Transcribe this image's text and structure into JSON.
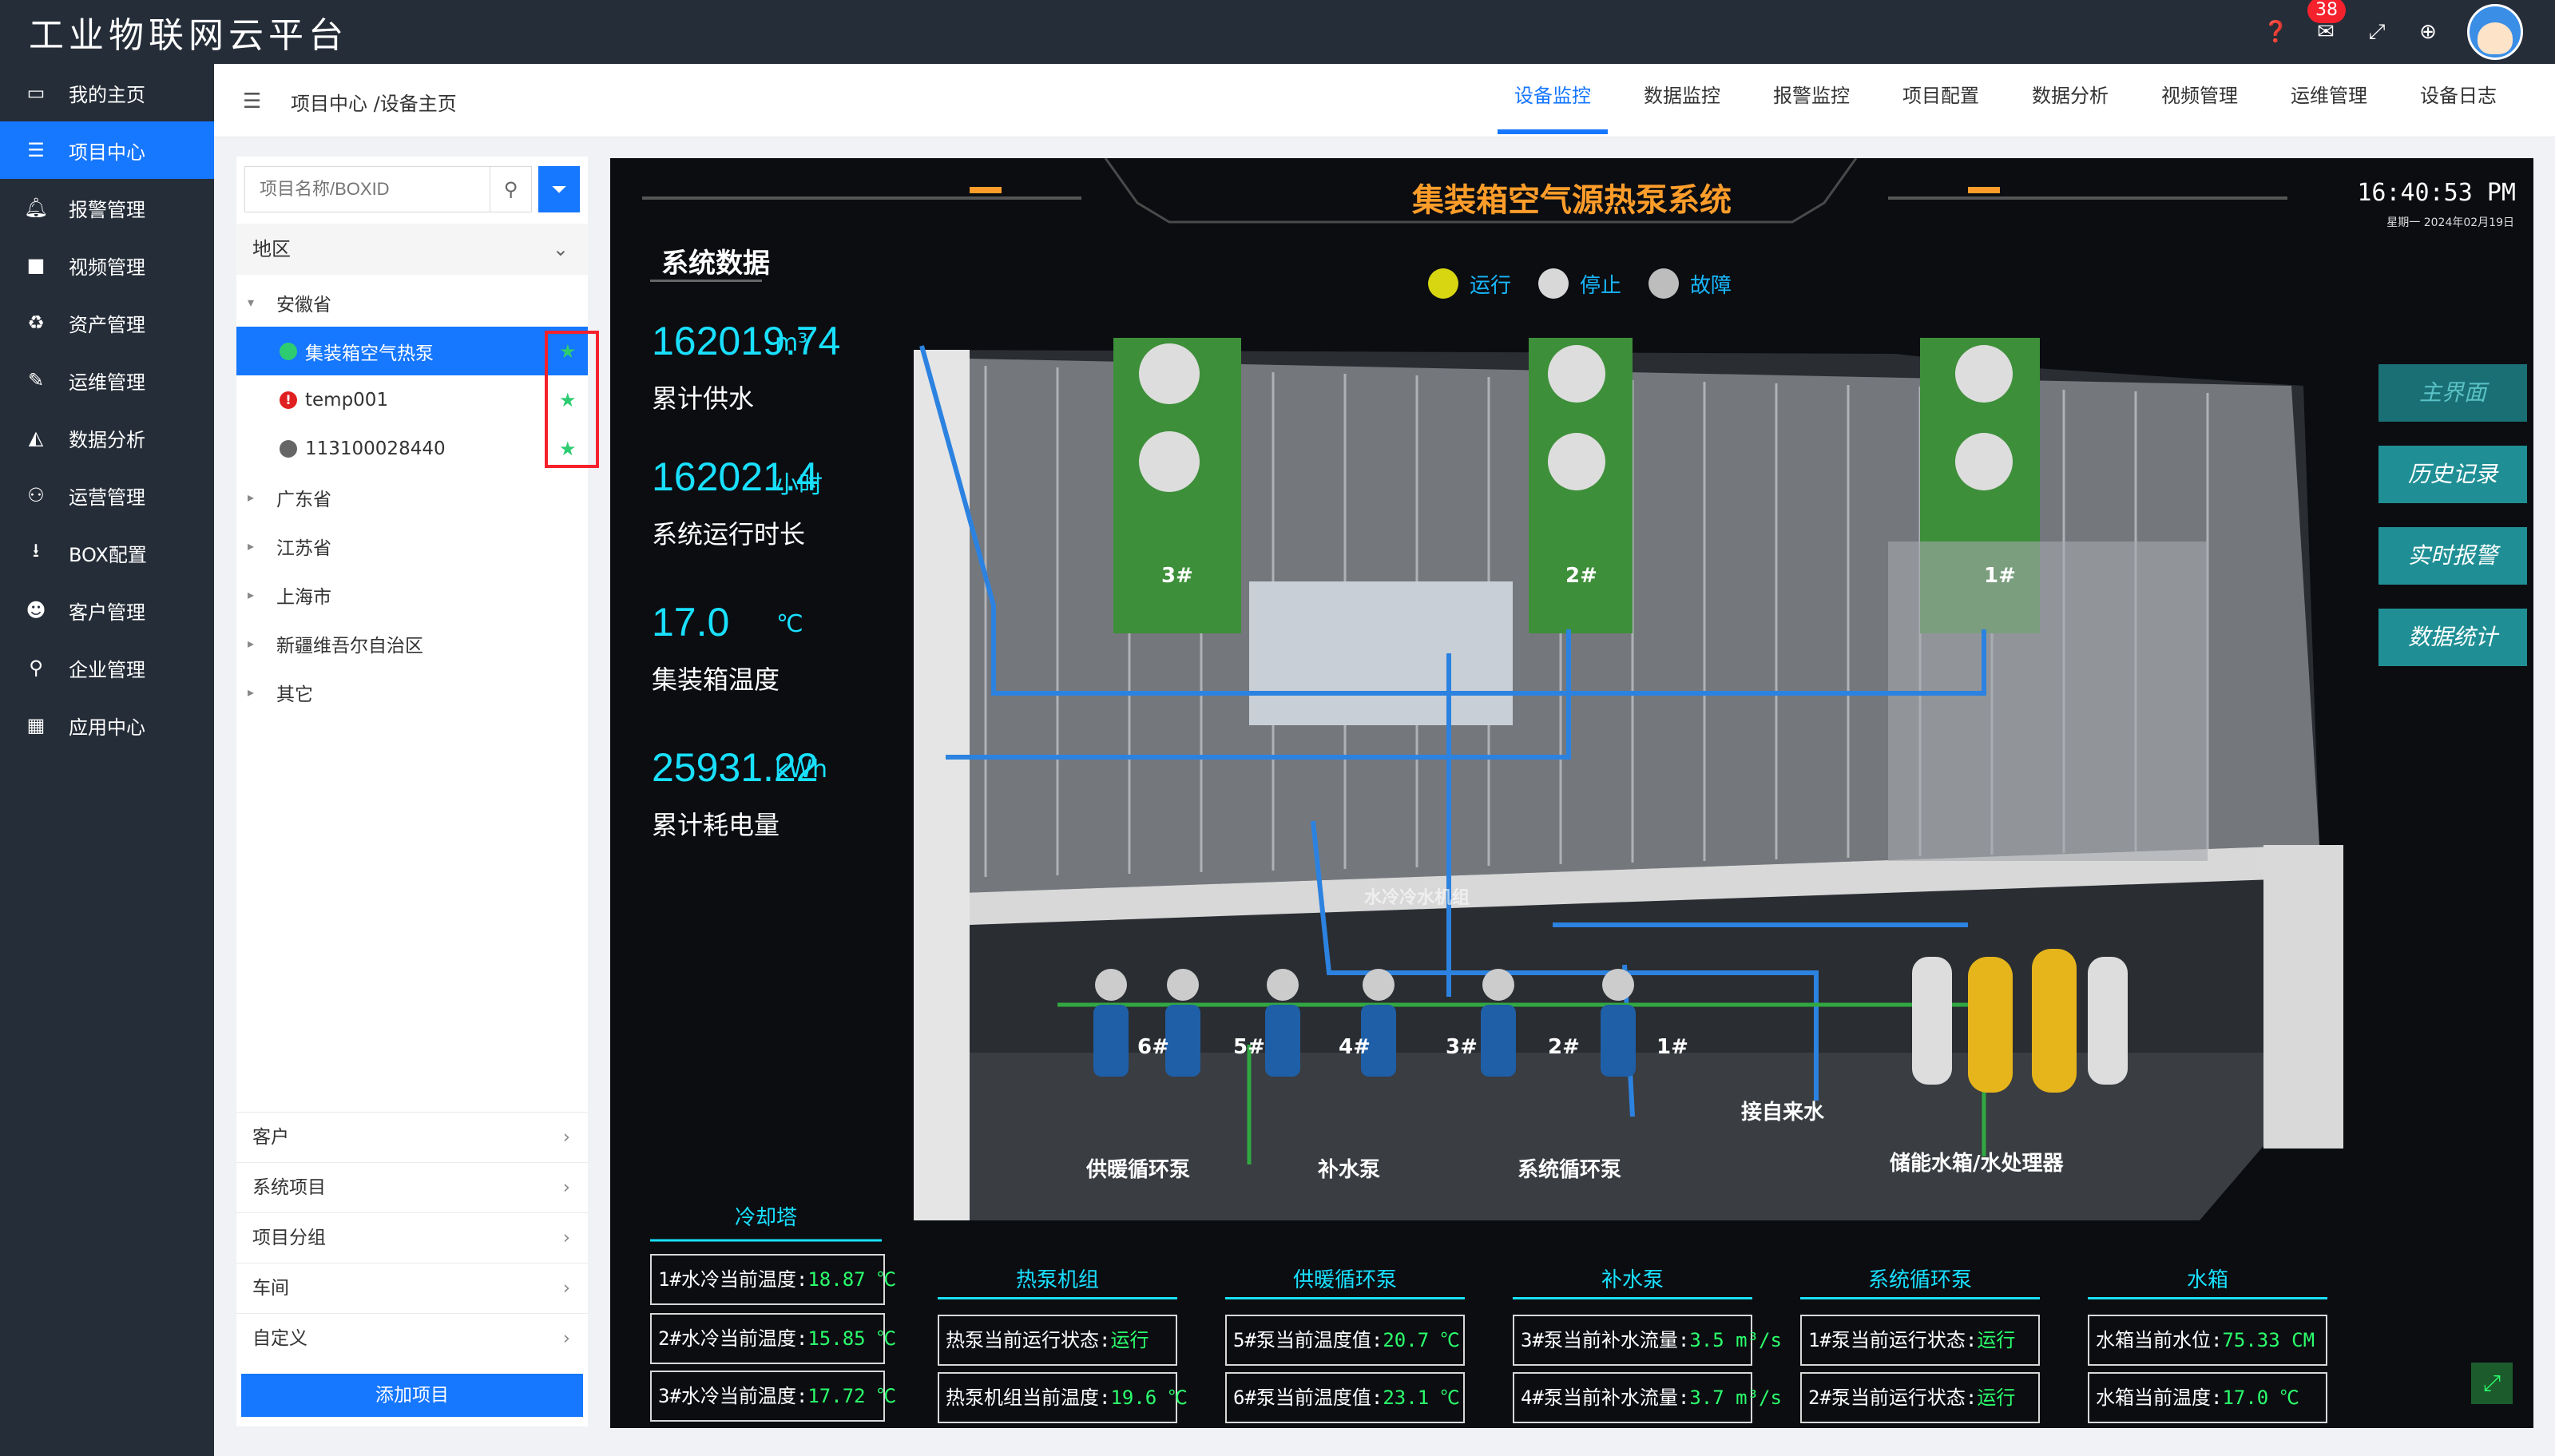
{
  "app": {
    "title": "工业物联网云平台",
    "notification_count": "38"
  },
  "sidebar": {
    "items": [
      {
        "label": "我的主页",
        "icon": "monitor-icon"
      },
      {
        "label": "项目中心",
        "icon": "list-icon"
      },
      {
        "label": "报警管理",
        "icon": "bell-icon"
      },
      {
        "label": "视频管理",
        "icon": "video-icon"
      },
      {
        "label": "资产管理",
        "icon": "recycle-icon"
      },
      {
        "label": "运维管理",
        "icon": "wrench-icon"
      },
      {
        "label": "数据分析",
        "icon": "chart-icon"
      },
      {
        "label": "运营管理",
        "icon": "users-icon"
      },
      {
        "label": "BOX配置",
        "icon": "download-icon"
      },
      {
        "label": "客户管理",
        "icon": "group-icon"
      },
      {
        "label": "企业管理",
        "icon": "sitemap-icon"
      },
      {
        "label": "应用中心",
        "icon": "grid-icon"
      }
    ]
  },
  "breadcrumb": "项目中心 /设备主页",
  "tabs": [
    "设备监控",
    "数据监控",
    "报警监控",
    "项目配置",
    "数据分析",
    "视频管理",
    "运维管理",
    "设备日志"
  ],
  "search": {
    "placeholder": "项目名称/BOXID"
  },
  "region_label": "地区",
  "tree": {
    "province": "安徽省",
    "devices": [
      {
        "name": "集装箱空气热泵",
        "status": "green"
      },
      {
        "name": "temp001",
        "status": "red"
      },
      {
        "name": "113100028440",
        "status": "grey"
      }
    ],
    "other_regions": [
      "广东省",
      "江苏省",
      "上海市",
      "新疆维吾尔自治区",
      "其它"
    ]
  },
  "bottom_menu": [
    "客户",
    "系统项目",
    "项目分组",
    "车间",
    "自定义"
  ],
  "add_button": "添加项目",
  "scada": {
    "title": "集装箱空气源热泵系统",
    "time": "16:40:53 PM",
    "date": "星期一    2024年02月19日",
    "section_title": "系统数据",
    "stats": [
      {
        "value": "162019.74",
        "unit": "m³",
        "label": "累计供水"
      },
      {
        "value": "162021.4",
        "unit": "小时",
        "label": "系统运行时长"
      },
      {
        "value": "17.0",
        "unit": "℃",
        "label": "集装箱温度"
      },
      {
        "value": "25931.22",
        "unit": "kWh",
        "label": "累计耗电量"
      }
    ],
    "legend": [
      {
        "label": "运行",
        "color": "#d7d611"
      },
      {
        "label": "停止",
        "color": "#d8d8d8"
      },
      {
        "label": "故障",
        "color": "#bdbdbd"
      }
    ],
    "right_buttons": [
      "主界面",
      "历史记录",
      "实时报警",
      "数据统计"
    ],
    "scene_labels": {
      "units": [
        "3#",
        "2#",
        "1#"
      ],
      "pumps": [
        "6#",
        "5#",
        "4#",
        "3#",
        "2#",
        "1#"
      ],
      "chiller": "水冷冷水机组",
      "inlet": "接自来水",
      "heat_pump": "供暖循环泵",
      "makeup_pump": "补水泵",
      "sys_pump": "系统循环泵",
      "tank": "储能水箱/水处理器"
    },
    "panels": [
      {
        "title": "冷却塔",
        "rows": [
          {
            "label": "1#水冷当前温度:",
            "value": "18.87 ℃"
          },
          {
            "label": "2#水冷当前温度:",
            "value": "15.85 ℃"
          },
          {
            "label": "3#水冷当前温度:",
            "value": "17.72 ℃"
          }
        ]
      },
      {
        "title": "热泵机组",
        "rows": [
          {
            "label": "热泵当前运行状态:",
            "value": "运行"
          },
          {
            "label": "热泵机组当前温度:",
            "value": "19.6 ℃"
          }
        ]
      },
      {
        "title": "供暖循环泵",
        "rows": [
          {
            "label": "5#泵当前温度值:",
            "value": "20.7 ℃"
          },
          {
            "label": "6#泵当前温度值:",
            "value": "23.1 ℃"
          }
        ]
      },
      {
        "title": "补水泵",
        "rows": [
          {
            "label": "3#泵当前补水流量:",
            "value": "3.5 m³/s"
          },
          {
            "label": "4#泵当前补水流量:",
            "value": "3.7 m³/s"
          }
        ]
      },
      {
        "title": "系统循环泵",
        "rows": [
          {
            "label": "1#泵当前运行状态:",
            "value": "运行"
          },
          {
            "label": "2#泵当前运行状态:",
            "value": "运行"
          }
        ]
      },
      {
        "title": "水箱",
        "rows": [
          {
            "label": "水箱当前水位:",
            "value": "75.33 CM"
          },
          {
            "label": "水箱当前温度:",
            "value": "17.0 ℃"
          }
        ]
      }
    ]
  }
}
